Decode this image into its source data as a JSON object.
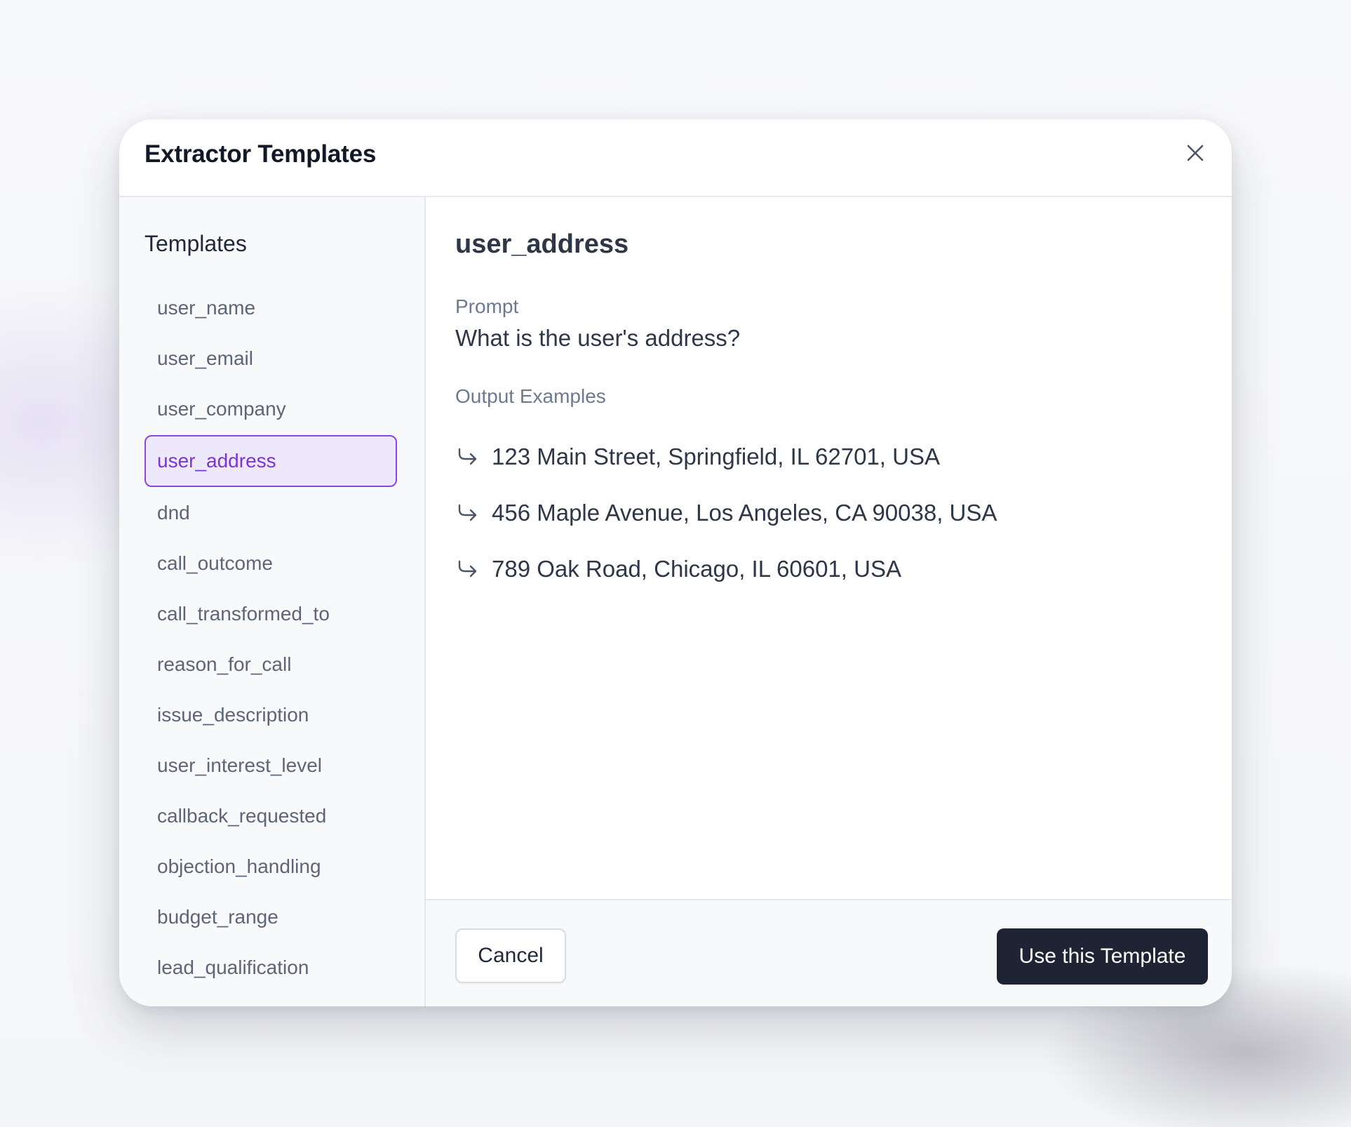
{
  "modal": {
    "title": "Extractor Templates",
    "close_icon": "close-icon"
  },
  "sidebar": {
    "heading": "Templates",
    "selected": "user_address",
    "items": [
      {
        "label": "user_name"
      },
      {
        "label": "user_email"
      },
      {
        "label": "user_company"
      },
      {
        "label": "user_address"
      },
      {
        "label": "dnd"
      },
      {
        "label": "call_outcome"
      },
      {
        "label": "call_transformed_to"
      },
      {
        "label": "reason_for_call"
      },
      {
        "label": "issue_description"
      },
      {
        "label": "user_interest_level"
      },
      {
        "label": "callback_requested"
      },
      {
        "label": "objection_handling"
      },
      {
        "label": "budget_range"
      },
      {
        "label": "lead_qualification"
      }
    ]
  },
  "detail": {
    "title": "user_address",
    "prompt_label": "Prompt",
    "prompt_text": "What is the user's address?",
    "examples_label": "Output Examples",
    "examples_icon": "return-arrow-icon",
    "examples": [
      "123 Main Street, Springfield, IL 62701, USA",
      "456 Maple Avenue, Los Angeles, CA 90038, USA",
      "789 Oak Road, Chicago, IL 60601, USA"
    ]
  },
  "footer": {
    "cancel_label": "Cancel",
    "use_label": "Use this Template"
  },
  "colors": {
    "accent": "#8b46e0",
    "selected_bg": "#eee8fb",
    "primary_button": "#1e2433"
  }
}
